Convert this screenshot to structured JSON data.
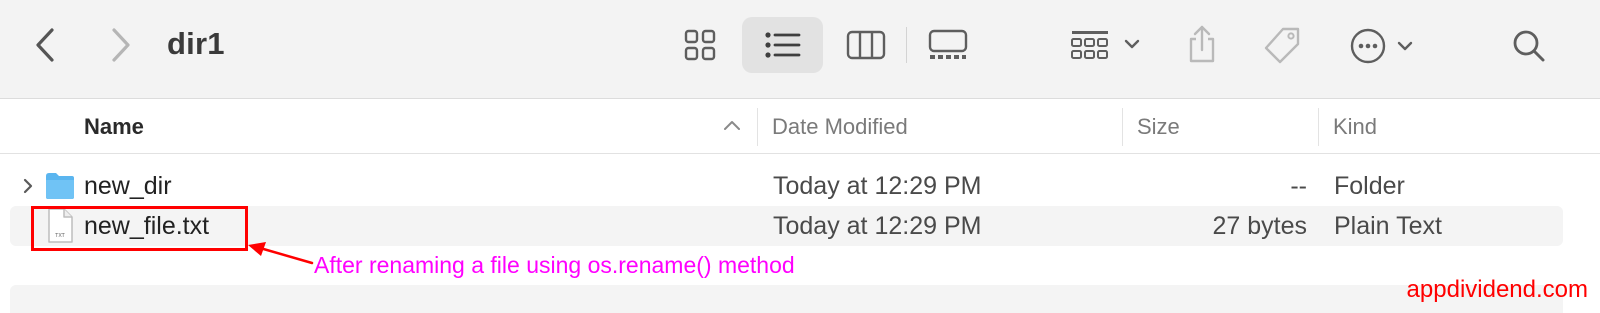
{
  "window": {
    "title": "dir1"
  },
  "toolbar": {
    "back_icon": "chevron-left-icon",
    "forward_icon": "chevron-right-icon",
    "views": [
      "icon-view",
      "list-view",
      "column-view",
      "gallery-view"
    ],
    "active_view": "list-view",
    "group_icon": "group-by-icon",
    "share_icon": "share-icon",
    "tag_icon": "tag-icon",
    "more_icon": "ellipsis-circle-icon",
    "search_icon": "search-icon"
  },
  "columns": {
    "name": "Name",
    "date": "Date Modified",
    "size": "Size",
    "kind": "Kind"
  },
  "files": [
    {
      "name": "new_dir",
      "date": "Today at 12:29 PM",
      "size": "--",
      "kind": "Folder",
      "icon": "folder-icon",
      "expandable": true
    },
    {
      "name": "new_file.txt",
      "date": "Today at 12:29 PM",
      "size": "27 bytes",
      "kind": "Plain Text",
      "icon": "text-file-icon",
      "expandable": false
    }
  ],
  "annotation": {
    "note": "After renaming a file using os.rename() method",
    "color": "#ff00ff",
    "box_color": "#ff0000"
  },
  "watermark": "appdividend.com",
  "colors": {
    "folder": "#5ab5ef",
    "toolbar_bg": "#f3f3f3",
    "icon": "#6e6e6e"
  }
}
